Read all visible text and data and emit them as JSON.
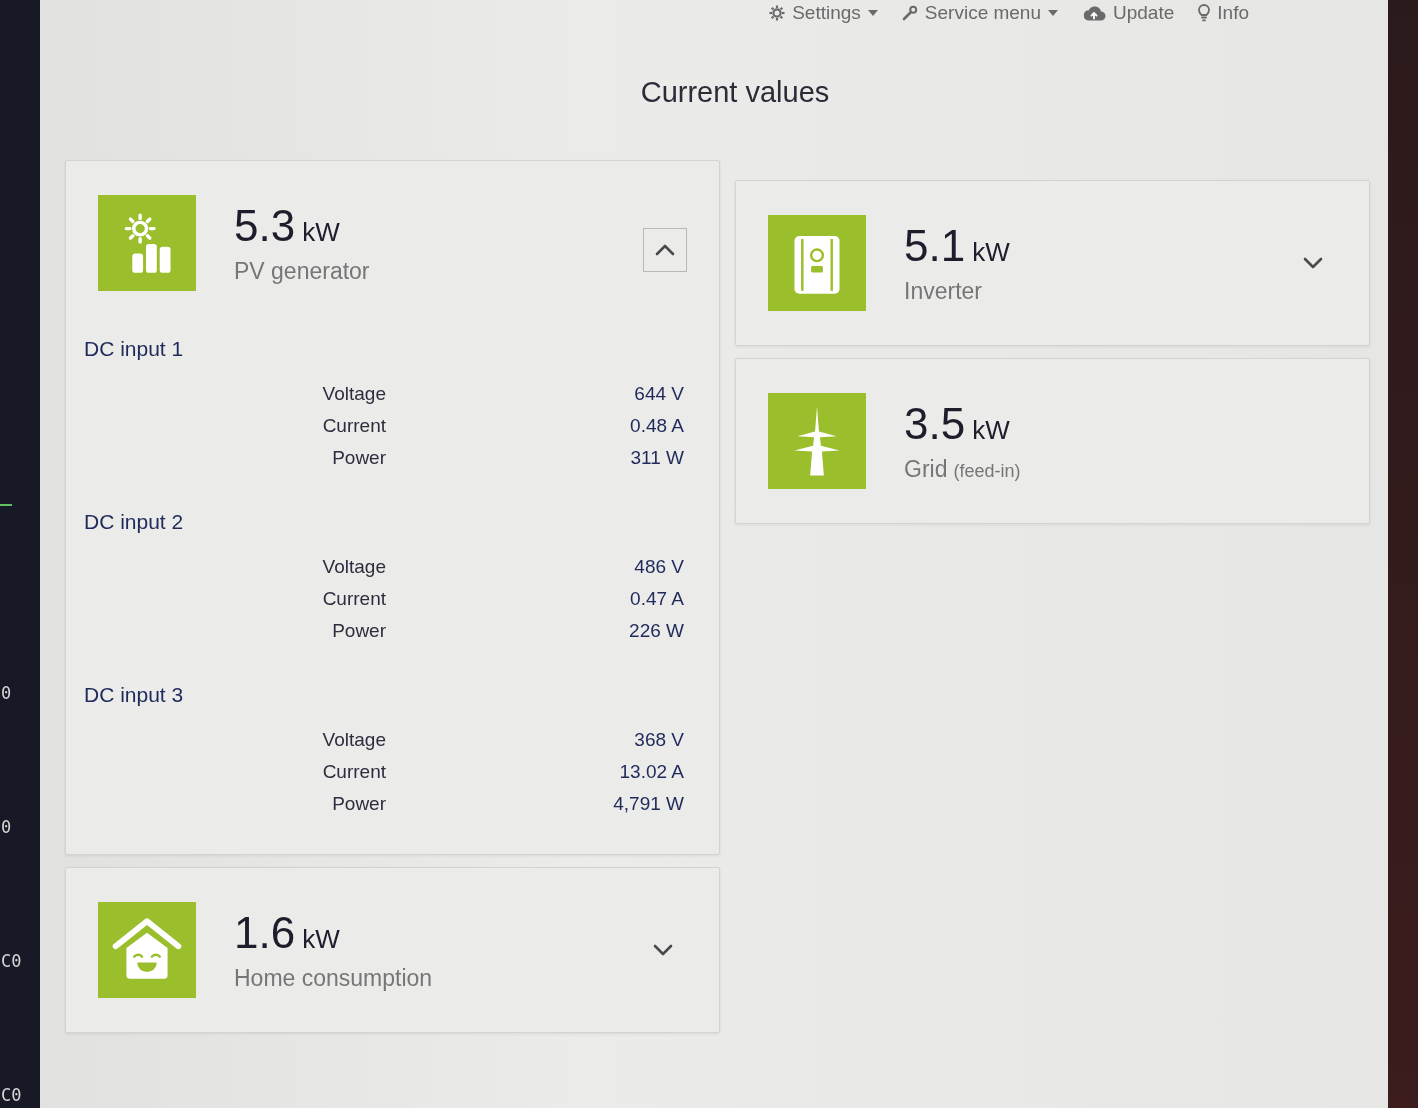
{
  "menu": [
    {
      "label": "Settings",
      "dropdown": true
    },
    {
      "label": "Service menu",
      "dropdown": true
    },
    {
      "label": "Update",
      "dropdown": false
    },
    {
      "label": "Info",
      "dropdown": false
    }
  ],
  "title": "Current values",
  "left_column": [
    {
      "value": "5.3",
      "unit": "kW",
      "label": "PV generator",
      "expanded": true,
      "sections": [
        {
          "title": "DC input 1",
          "rows": [
            {
              "name": "Voltage",
              "value": "644 V"
            },
            {
              "name": "Current",
              "value": "0.48 A"
            },
            {
              "name": "Power",
              "value": "311 W"
            }
          ]
        },
        {
          "title": "DC input 2",
          "rows": [
            {
              "name": "Voltage",
              "value": "486 V"
            },
            {
              "name": "Current",
              "value": "0.47 A"
            },
            {
              "name": "Power",
              "value": "226 W"
            }
          ]
        },
        {
          "title": "DC input 3",
          "rows": [
            {
              "name": "Voltage",
              "value": "368 V"
            },
            {
              "name": "Current",
              "value": "13.02 A"
            },
            {
              "name": "Power",
              "value": "4,791 W"
            }
          ]
        }
      ]
    },
    {
      "value": "1.6",
      "unit": "kW",
      "label": "Home consumption",
      "expanded": false
    }
  ],
  "right_column": [
    {
      "value": "5.1",
      "unit": "kW",
      "label": "Inverter",
      "expanded": false
    },
    {
      "value": "3.5",
      "unit": "kW",
      "label": "Grid",
      "note": "(feed-in)"
    }
  ],
  "terminal": {
    "lines": [
      "0",
      "0",
      "C0",
      "C0"
    ]
  }
}
